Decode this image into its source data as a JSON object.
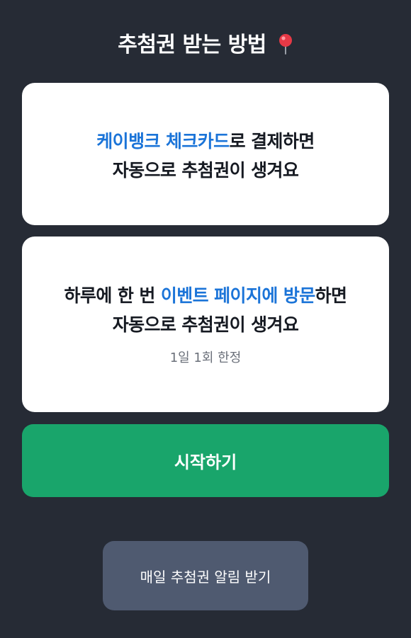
{
  "header": {
    "title": "추첨권 받는 방법",
    "title_icon": "pushpin-icon"
  },
  "cards": [
    {
      "line1_highlight": "케이뱅크 체크카드",
      "line1_rest": "로 결제하면",
      "line2": "자동으로 추첨권이 생겨요"
    },
    {
      "line1_pre": "하루에 한 번 ",
      "line1_highlight": "이벤트 페이지에 방문",
      "line1_rest": "하면",
      "line2": "자동으로 추첨권이 생겨요",
      "note": "1일 1회 한정"
    }
  ],
  "buttons": {
    "start_label": "시작하기",
    "alarm_label": "매일 추첨권 알림 받기"
  },
  "colors": {
    "background": "#262b35",
    "accent_text": "#1b74d8",
    "primary_button": "#19a56b",
    "secondary_button": "#4f5a70"
  }
}
